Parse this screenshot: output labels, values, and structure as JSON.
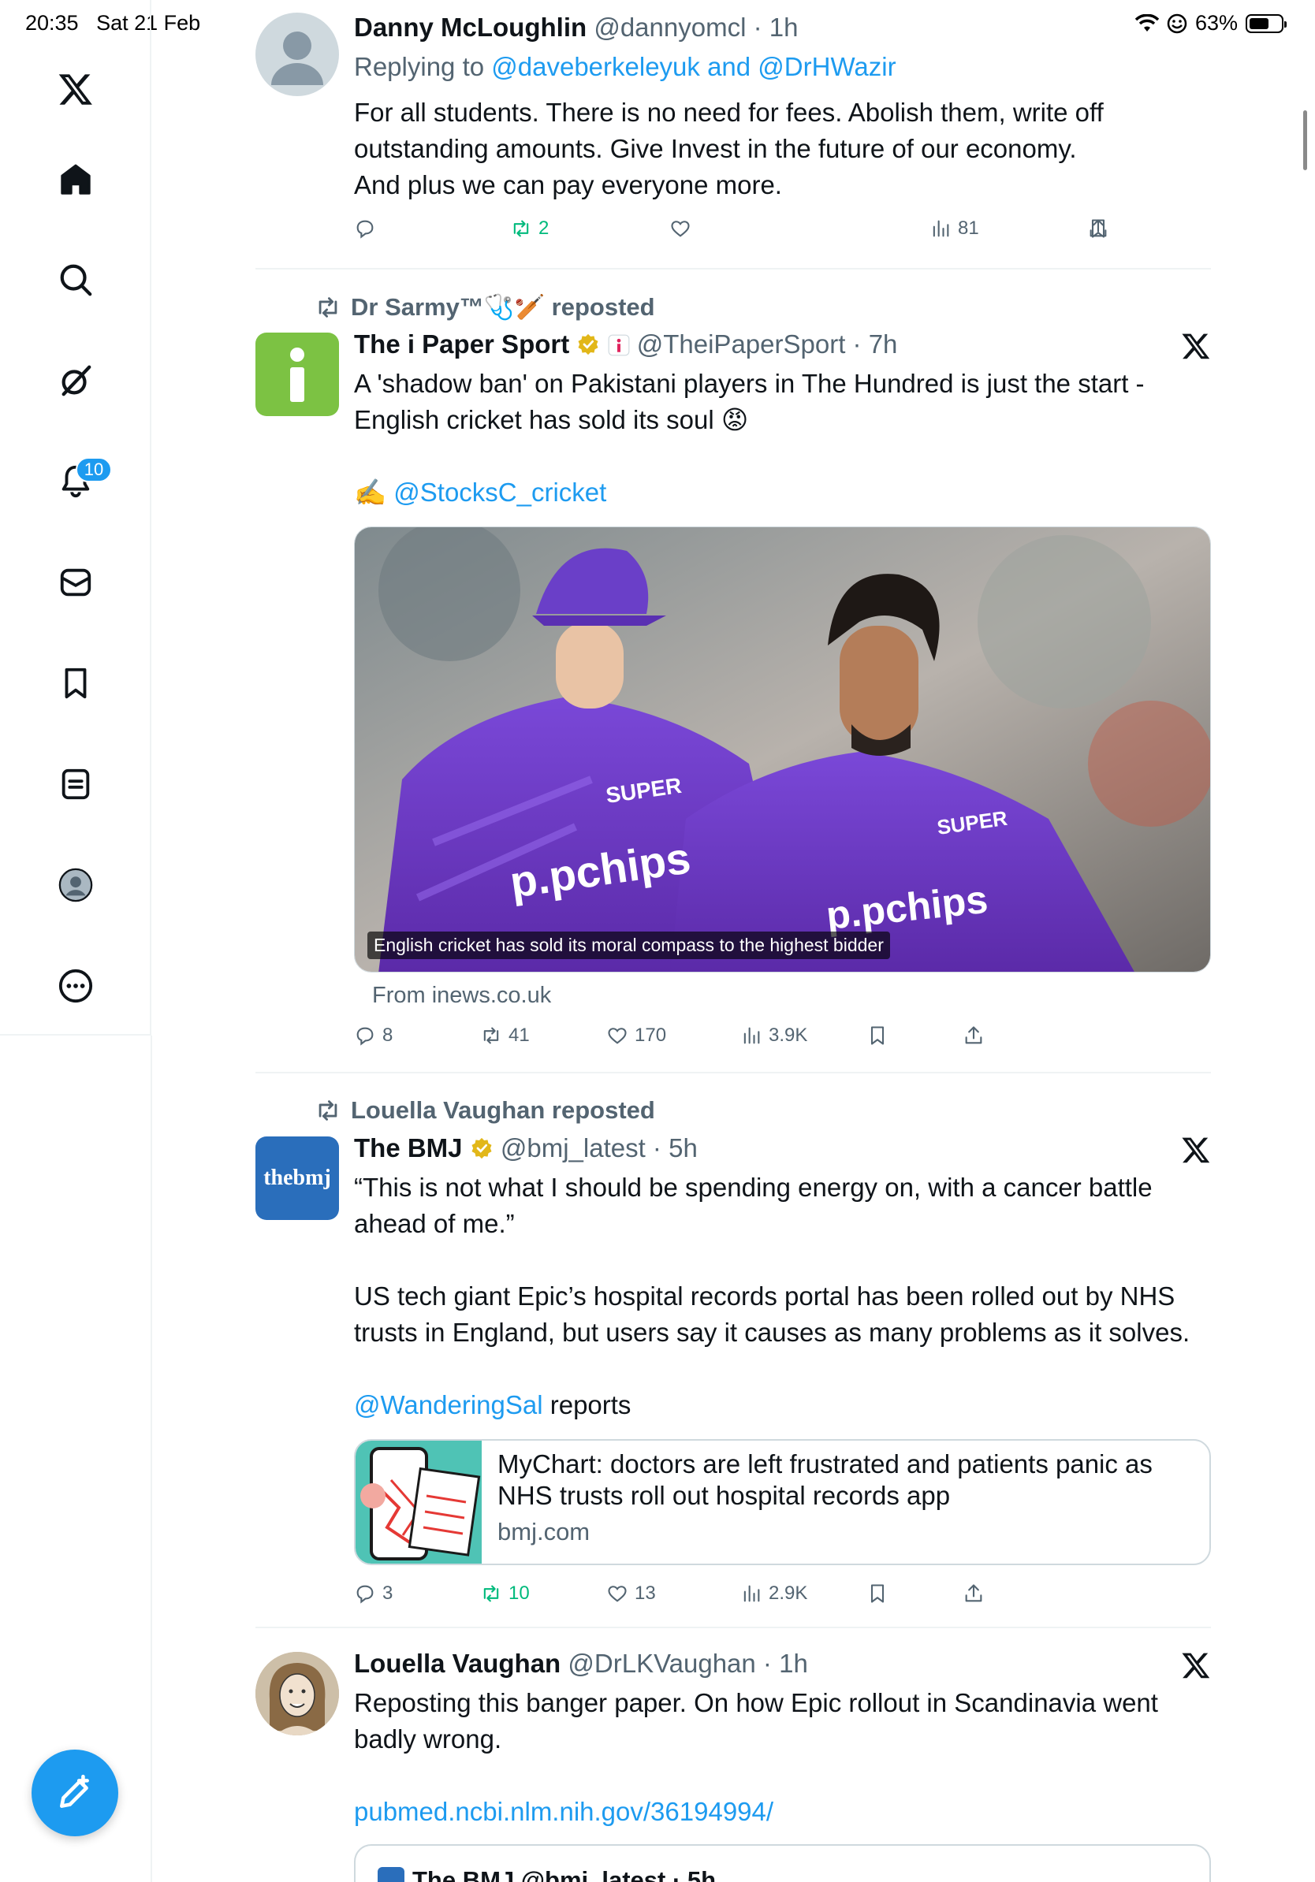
{
  "status_bar": {
    "time": "20:35",
    "date": "Sat 21 Feb",
    "battery": "63%",
    "battery_level": 0.63
  },
  "sidebar": {
    "items": [
      {
        "name": "x-logo-icon"
      },
      {
        "name": "home-icon"
      },
      {
        "name": "search-icon"
      },
      {
        "name": "grok-icon"
      },
      {
        "name": "notifications-icon",
        "badge": "10"
      },
      {
        "name": "messages-icon"
      },
      {
        "name": "bookmarks-icon"
      },
      {
        "name": "lists-icon"
      },
      {
        "name": "profile-icon"
      },
      {
        "name": "more-icon"
      }
    ]
  },
  "posts": [
    {
      "author": "Danny McLoughlin",
      "handle": "@dannyomcl",
      "time": "1h",
      "replying_prefix": "Replying to ",
      "replying_to": "@daveberkeleyuk and @DrHWazir",
      "text": [
        "For all students. There is no need for fees. Abolish them, write off",
        "outstanding amounts. Give Invest in the future of our economy.",
        "And plus we can pay everyone more."
      ],
      "replies": "",
      "reposts": "2",
      "likes": "",
      "views": "81"
    },
    {
      "reposted_by": "Dr Sarmy™🩺🏏 reposted",
      "author": "The i Paper Sport",
      "handle": "@TheiPaperSport",
      "time": "7h",
      "text": [
        "A 'shadow ban' on Pakistani players in The Hundred is just the start -",
        "English cricket has sold its soul 😡"
      ],
      "mention_prefix": "✍️ ",
      "mention": "@StocksC_cricket",
      "media_caption": "English cricket has sold its moral compass to the highest bidder",
      "source": "From inews.co.uk",
      "replies": "8",
      "reposts": "41",
      "likes": "170",
      "views": "3.9K"
    },
    {
      "reposted_by": "Louella Vaughan reposted",
      "author": "The BMJ",
      "handle": "@bmj_latest",
      "time": "5h",
      "avatar_text": "thebmj",
      "text": [
        "“This is not what I should be spending energy on, with a cancer battle",
        "ahead of me.”"
      ],
      "text2": [
        "US tech giant Epic’s hospital records portal has been rolled out by NHS",
        "trusts in England, but users say it causes as many problems as it solves."
      ],
      "mention": "@WanderingSal",
      "mention_suffix": " reports",
      "card": {
        "title_line1": "MyChart: doctors are left frustrated and patients panic as",
        "title_line2": "NHS trusts roll out hospital records app",
        "domain": "bmj.com"
      },
      "replies": "3",
      "reposts": "10",
      "likes": "13",
      "views": "2.9K"
    },
    {
      "author": "Louella Vaughan",
      "handle": "@DrLKVaughan",
      "time": "1h",
      "text": [
        "Reposting this banger paper. On how Epic rollout in Scandinavia went",
        "badly wrong."
      ],
      "link": "pubmed.ncbi.nlm.nih.gov/36194994/",
      "quote_preview": "The BMJ  @bmj_latest · 5h"
    }
  ],
  "colors": {
    "accent": "#1d9bf0",
    "repost_green": "#00ba7c",
    "secondary_text": "#536471",
    "verified_gold": "#e2b719",
    "ipaper_green": "#7cc243",
    "bmj_blue": "#2a6ebb"
  }
}
